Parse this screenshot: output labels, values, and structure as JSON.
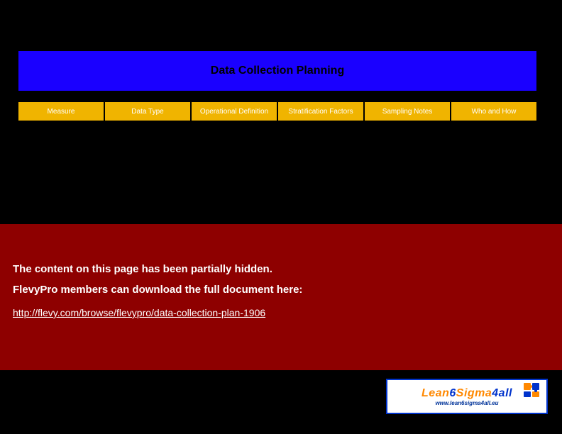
{
  "slide": {
    "title": "Data Collection Planning"
  },
  "columns": [
    {
      "label": "Measure"
    },
    {
      "label": "Data Type"
    },
    {
      "label": "Operational Definition"
    },
    {
      "label": "Stratification Factors"
    },
    {
      "label": "Sampling Notes"
    },
    {
      "label": "Who and How"
    }
  ],
  "overlay": {
    "line1": "The content on this page has been partially hidden.",
    "line2": "FlevyPro members can download the full document here:",
    "link_text": "http://flevy.com/browse/flevypro/data-collection-plan-1906"
  },
  "logo": {
    "part1": "Lean",
    "part2": "6",
    "part3": "Sigma",
    "part4": "4all",
    "url": "www.lean6sigma4all.eu"
  }
}
